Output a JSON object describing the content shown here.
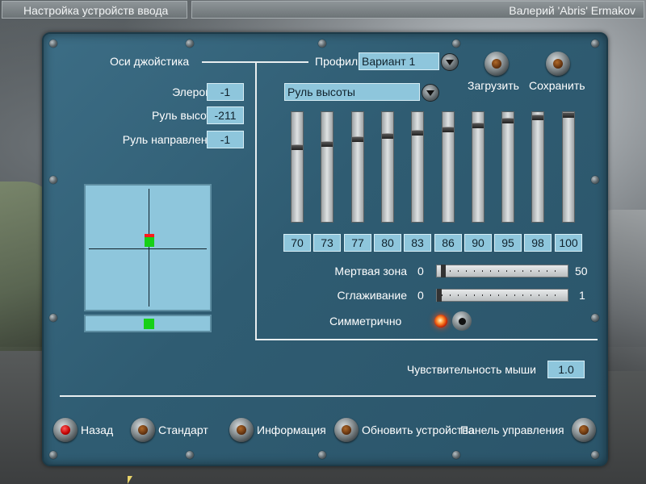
{
  "window": {
    "title": "Настройка устройств ввода",
    "user": "Валерий 'Abris' Ermakov"
  },
  "axes": {
    "section_title": "Оси джойстика",
    "rows": [
      {
        "label": "Элероны",
        "value": "-1"
      },
      {
        "label": "Руль высоты",
        "value": "-211"
      },
      {
        "label": "Руль направления",
        "value": "-1"
      }
    ]
  },
  "profile": {
    "label": "Профил",
    "value": "Вариант 1",
    "load_label": "Загрузить",
    "save_label": "Сохранить"
  },
  "axis_select": {
    "value": "Руль высоты"
  },
  "curve": {
    "values": [
      "70",
      "73",
      "77",
      "80",
      "83",
      "86",
      "90",
      "95",
      "98",
      "100"
    ],
    "levels": [
      0.3,
      0.27,
      0.23,
      0.2,
      0.17,
      0.14,
      0.1,
      0.05,
      0.02,
      0.0
    ]
  },
  "deadzone": {
    "label": "Мертвая зона",
    "min": "0",
    "max": "50",
    "value_fraction": 0.02
  },
  "smoothing": {
    "label": "Сглаживание",
    "min": "0",
    "max": "1",
    "value_fraction": 0.0
  },
  "symmetric": {
    "label": "Симметрично",
    "on": true
  },
  "mouse": {
    "label": "Чувствительность мыши",
    "value": "1.0"
  },
  "bottom": {
    "back": "Назад",
    "standard": "Стандарт",
    "info": "Информация",
    "refresh": "Обновить устройства",
    "control_panel": "Панель управления"
  },
  "icons": {
    "knob": "toggle-knob-icon",
    "dropdown": "chevron-down-icon"
  },
  "colors": {
    "panel": "#2f5c72",
    "field": "#8ec6dc",
    "stick_dot": "#17d017",
    "stick_marker": "#ff1a1a"
  }
}
